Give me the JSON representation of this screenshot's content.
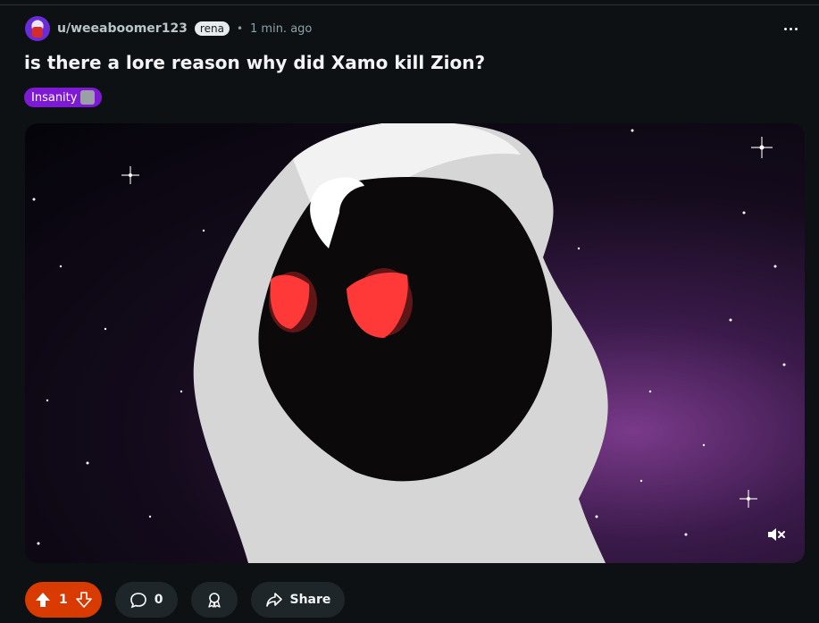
{
  "post": {
    "author": "u/weeaboomer123",
    "author_flair": "rena",
    "separator": "•",
    "time": "1 min. ago",
    "title": "is there a lore reason why did Xamo kill Zion?",
    "flair": "Insanity"
  },
  "actions": {
    "vote_count": "1",
    "comment_count": "0",
    "share_label": "Share"
  },
  "icons": {
    "more": "more-options-icon",
    "upvote": "upvote-arrow-icon",
    "downvote": "downvote-arrow-icon",
    "comment": "comment-bubble-icon",
    "award": "award-icon",
    "share": "share-arrow-icon",
    "mute": "muted-speaker-icon"
  },
  "colors": {
    "background": "#0e1113",
    "vote_accent": "#d93a00",
    "flair_purple": "#7e19d6",
    "eye_glow": "#ff3030"
  }
}
